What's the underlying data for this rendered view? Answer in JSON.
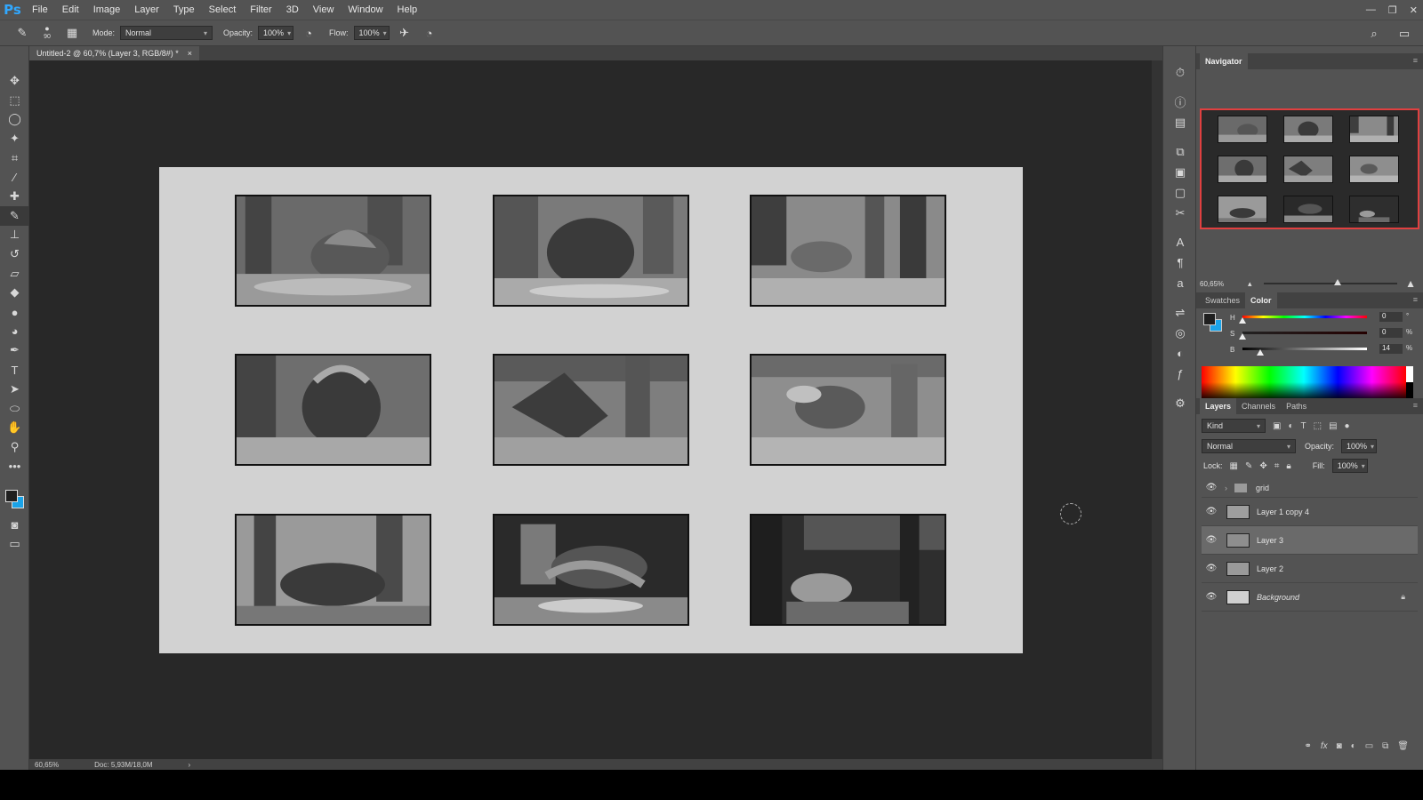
{
  "app": {
    "logo": "Ps"
  },
  "menu": [
    "File",
    "Edit",
    "Image",
    "Layer",
    "Type",
    "Select",
    "Filter",
    "3D",
    "View",
    "Window",
    "Help"
  ],
  "window_controls": [
    "—",
    "❐",
    "✕"
  ],
  "options": {
    "brush_size": "90",
    "mode_label": "Mode:",
    "mode_value": "Normal",
    "opacity_label": "Opacity:",
    "opacity_value": "100%",
    "flow_label": "Flow:",
    "flow_value": "100%"
  },
  "document": {
    "tab_title": "Untitled-2 @ 60,7% (Layer 3, RGB/8#) *",
    "close": "×",
    "zoom_status": "60,65%",
    "doc_status": "Doc: 5,93M/18,0M",
    "status_arrow": "›"
  },
  "navigator": {
    "title": "Navigator",
    "zoom": "60,65%",
    "zoom_fraction": 0.55
  },
  "color_panel": {
    "tabs": [
      "Swatches",
      "Color"
    ],
    "active_tab": "Color",
    "fg_color": "#1f1f1f",
    "bg_color": "#1aa3e8",
    "channels": [
      {
        "label": "H",
        "value": "0",
        "unit": "°"
      },
      {
        "label": "S",
        "value": "0",
        "unit": "%"
      },
      {
        "label": "B",
        "value": "14",
        "unit": "%"
      }
    ]
  },
  "layers_panel": {
    "tabs": [
      "Layers",
      "Channels",
      "Paths"
    ],
    "active_tab": "Layers",
    "kind_label": "Kind",
    "blend_mode": "Normal",
    "opacity_label": "Opacity:",
    "opacity_value": "100%",
    "lock_label": "Lock:",
    "fill_label": "Fill:",
    "fill_value": "100%",
    "layers": [
      {
        "name": "grid",
        "type": "group",
        "visible": true,
        "selected": false
      },
      {
        "name": "Layer 1 copy 4",
        "type": "layer",
        "visible": true,
        "selected": false
      },
      {
        "name": "Layer 3",
        "type": "layer",
        "visible": true,
        "selected": true
      },
      {
        "name": "Layer 2",
        "type": "layer",
        "visible": true,
        "selected": false
      },
      {
        "name": "Background",
        "type": "background",
        "visible": true,
        "selected": false,
        "locked": true
      }
    ]
  }
}
